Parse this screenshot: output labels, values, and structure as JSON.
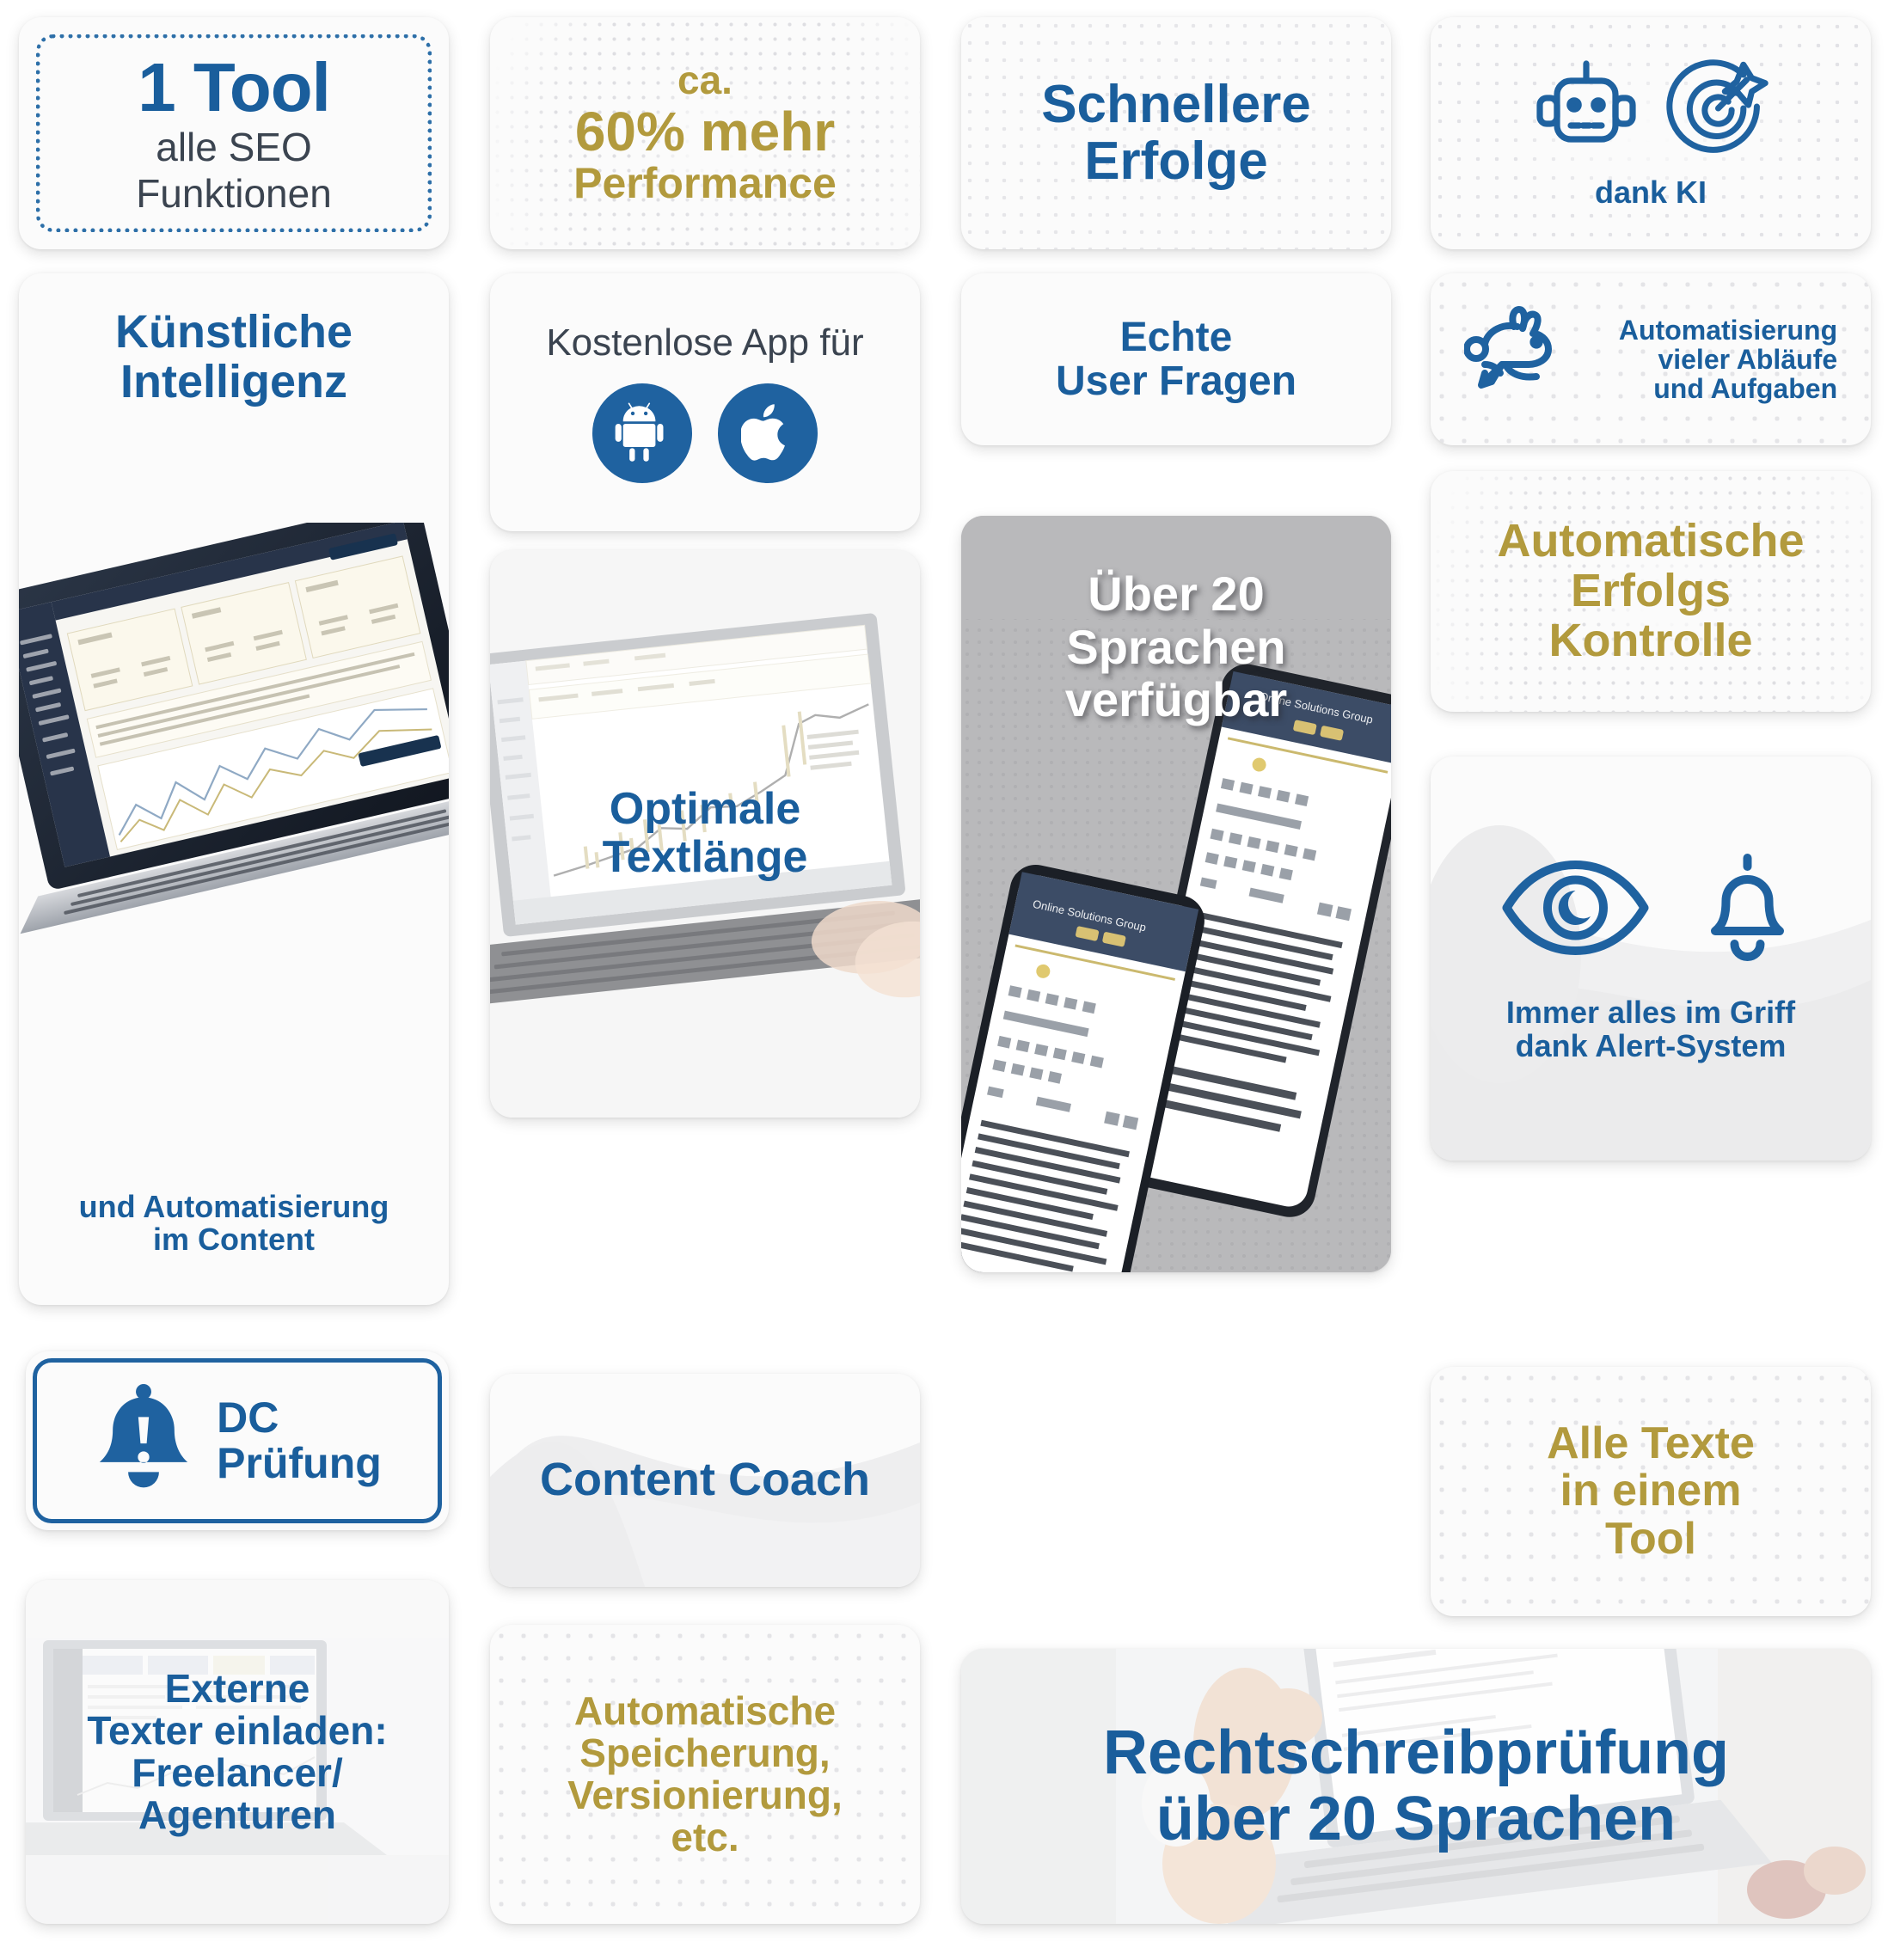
{
  "cards": {
    "one_tool": {
      "headline": "1 Tool",
      "line2": "alle SEO",
      "line3": "Funktionen"
    },
    "performance": {
      "line1": "ca.",
      "line2": "60% mehr",
      "line3": "Performance"
    },
    "faster": {
      "line1": "Schnellere",
      "line2": "Erfolge"
    },
    "ki": {
      "caption": "dank KI",
      "icon_robot": "robot-icon",
      "icon_target": "target-icon"
    },
    "ai": {
      "line1": "Künstliche",
      "line2": "Intelligenz",
      "caption1": "und Automatisierung",
      "caption2": "im Content"
    },
    "app": {
      "title": "Kostenlose App für",
      "icon_android": "android-icon",
      "icon_apple": "apple-icon"
    },
    "user_questions": {
      "line1": "Echte",
      "line2": "User Fragen"
    },
    "rabbit": {
      "line1": "Automatisierung",
      "line2": "vieler Abläufe",
      "line3": "und Aufgaben",
      "icon": "rabbit-icon"
    },
    "text_length": {
      "line1": "Optimale",
      "line2": "Textlänge"
    },
    "languages": {
      "line1": "Über 20",
      "line2": "Sprachen",
      "line3": "verfügbar",
      "phone_brand": "Online Solutions Group"
    },
    "erfolgs": {
      "line1": "Automatische",
      "line2": "Erfolgs",
      "line3": "Kontrolle"
    },
    "alert": {
      "line1": "Immer alles im Griff",
      "line2": "dank Alert-System",
      "icon_eye": "eye-icon",
      "icon_bell": "bell-icon"
    },
    "dc": {
      "line1": "DC",
      "line2": "Prüfung",
      "icon": "bell-alert-icon"
    },
    "coach": {
      "title": "Content Coach"
    },
    "alle_texte": {
      "line1": "Alle Texte",
      "line2": "in einem",
      "line3": "Tool"
    },
    "extern": {
      "line1": "Externe",
      "line2": "Texter einladen:",
      "line3": "Freelancer/",
      "line4": "Agenturen"
    },
    "speicher": {
      "line1": "Automatische",
      "line2": "Speicherung,",
      "line3": "Versionierung,",
      "line4": "etc."
    },
    "rechtschreib": {
      "line1": "Rechtschreibprüfung",
      "line2": "über 20 Sprachen"
    }
  },
  "colors": {
    "blue": "#1a5e9c",
    "gold": "#b29a3d",
    "dark": "#3b4450",
    "card_bg": "#fbfbfb",
    "gray_photo": "#b9b9bb"
  }
}
